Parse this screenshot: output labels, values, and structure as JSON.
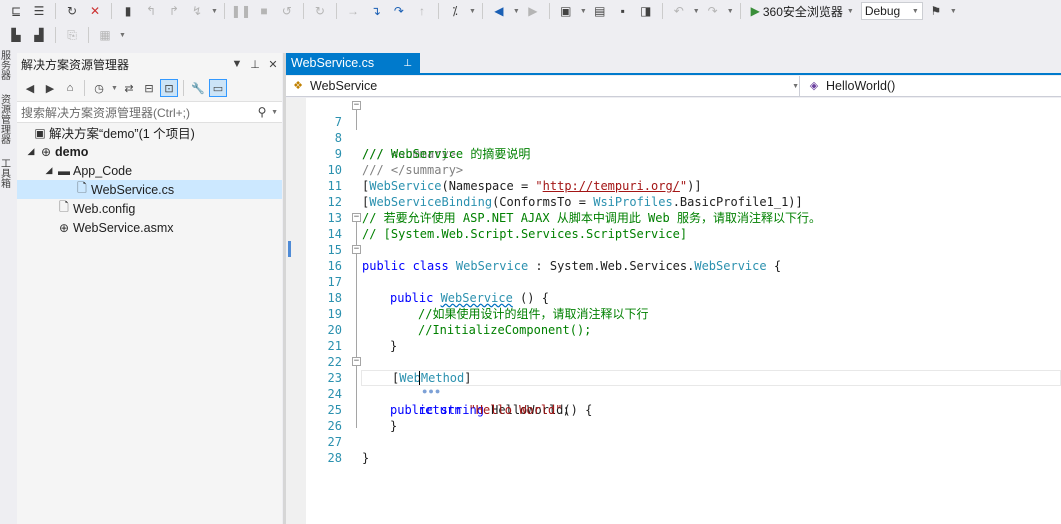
{
  "toolbar": {
    "run_target": "360安全浏览器",
    "configuration": "Debug"
  },
  "side_strip": {
    "tabs": [
      "服务器",
      "资源管理器",
      "工具箱"
    ]
  },
  "solution_explorer": {
    "title": "解决方案资源管理器",
    "search_placeholder": "搜索解决方案资源管理器(Ctrl+;)",
    "tree": [
      {
        "label": "解决方案“demo”(1 个项目)"
      },
      {
        "label": "demo"
      },
      {
        "label": "App_Code"
      },
      {
        "label": "WebService.cs"
      },
      {
        "label": "Web.config"
      },
      {
        "label": "WebService.asmx"
      }
    ]
  },
  "editor": {
    "tab_title": "WebService.cs",
    "nav_class": "WebService",
    "nav_member": "HelloWorld()",
    "line_numbers": [
      "7",
      "8",
      "9",
      "10",
      "11",
      "12",
      "13",
      "14",
      "15",
      "16",
      "17",
      "18",
      "19",
      "20",
      "21",
      "22",
      "23",
      "24",
      "25",
      "26",
      "27",
      "28"
    ],
    "code": {
      "l7": "/// <summary>",
      "l8": "/// WebService 的摘要说明",
      "l9": "/// </summary>",
      "l10_a": "[",
      "l10_b": "WebService",
      "l10_c": "(Namespace = ",
      "l10_d": "\"",
      "l10_e": "http://tempuri.org/",
      "l10_f": "\"",
      "l10_g": ")]",
      "l11_a": "[",
      "l11_b": "WebServiceBinding",
      "l11_c": "(ConformsTo = ",
      "l11_d": "WsiProfiles",
      "l11_e": ".BasicProfile1_1)]",
      "l12": "// 若要允许使用 ASP.NET AJAX 从脚本中调用此 Web 服务，请取消注释以下行。",
      "l13": "// [System.Web.Script.Services.ScriptService]",
      "l14_a": "public class ",
      "l14_b": "WebService",
      "l14_c": " : System.Web.Services.",
      "l14_d": "WebService",
      "l14_e": " {",
      "l16_a": "public ",
      "l16_b": "WebService",
      "l16_c": " () {",
      "l18": "//如果使用设计的组件，请取消注释以下行",
      "l19": "//InitializeComponent();",
      "l20": "}",
      "l22_a": "[",
      "l22_b": "WebMethod",
      "l22_c": "]",
      "l23_a": "public string ",
      "l23_b": "HelloWorld() {",
      "l24_a": "return ",
      "l24_b": "\"Hello World\"",
      "l24_c": ";",
      "l25": "}",
      "l27": "}"
    }
  }
}
